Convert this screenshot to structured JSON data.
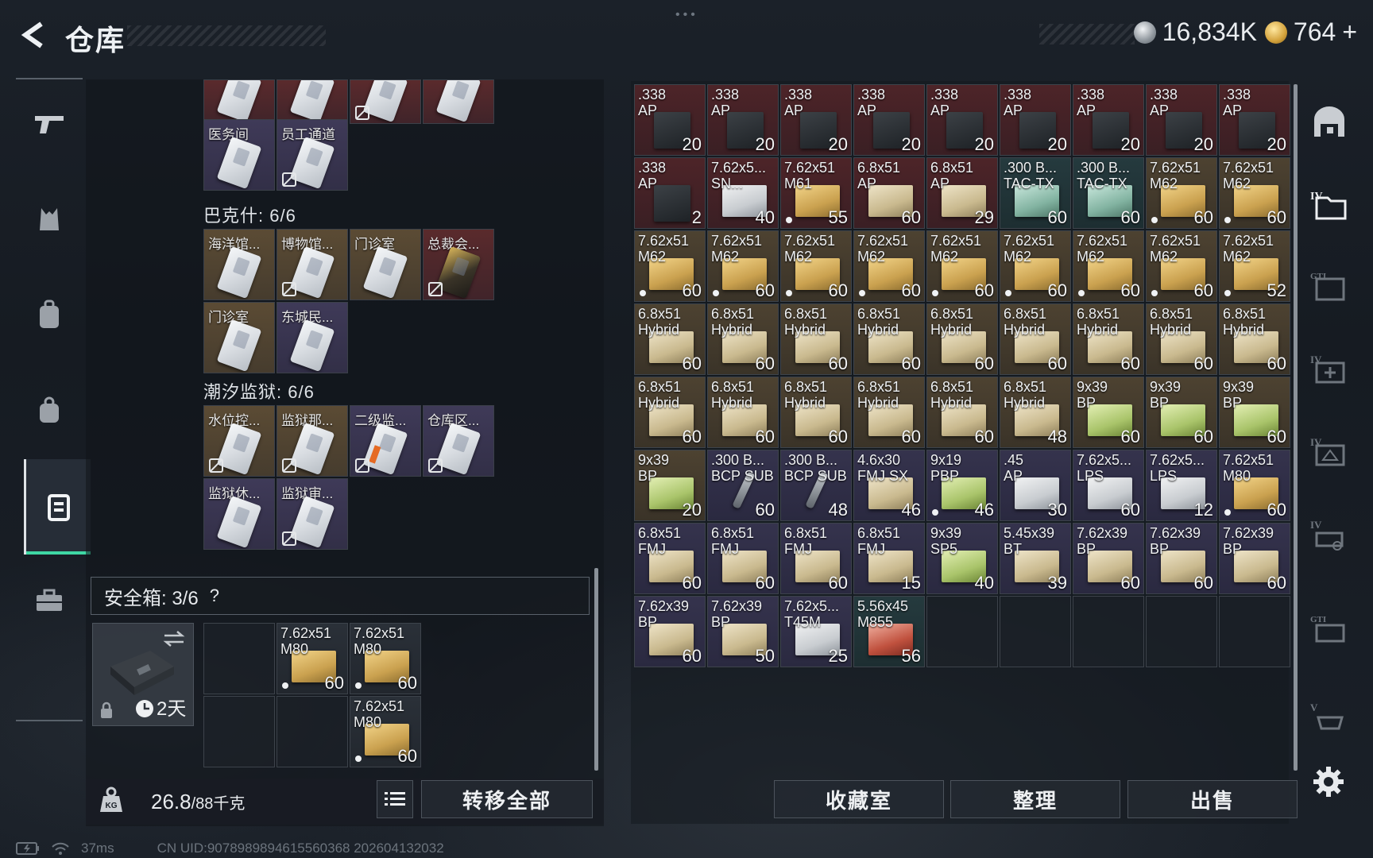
{
  "header": {
    "title": "仓库",
    "currency_silver": "16,834K",
    "currency_gold": "764",
    "plus": "+"
  },
  "left_panel": {
    "top_partial_row": [
      {
        "name": "",
        "color": "red",
        "nodrop": false
      },
      {
        "name": "",
        "color": "red",
        "nodrop": false
      },
      {
        "name": "",
        "color": "red",
        "nodrop": true
      },
      {
        "name": "",
        "color": "red",
        "nodrop": false
      }
    ],
    "row_a": [
      {
        "name": "医务间",
        "color": "purple",
        "nodrop": false
      },
      {
        "name": "员工通道",
        "color": "purple",
        "nodrop": true
      }
    ],
    "section_bakshi": "巴克什: 6/6",
    "row_b": [
      {
        "name": "海洋馆...",
        "color": "gold",
        "nodrop": false
      },
      {
        "name": "博物馆...",
        "color": "gold",
        "nodrop": true
      },
      {
        "name": "门诊室",
        "color": "gold",
        "nodrop": false
      },
      {
        "name": "总裁会...",
        "color": "red",
        "nodrop": true
      }
    ],
    "row_c": [
      {
        "name": "门诊室",
        "color": "gold",
        "nodrop": false
      },
      {
        "name": "东城民...",
        "color": "purple",
        "nodrop": false
      }
    ],
    "section_prison": "潮汐监狱: 6/6",
    "row_d": [
      {
        "name": "水位控...",
        "color": "gold",
        "nodrop": true
      },
      {
        "name": "监狱那...",
        "color": "gold",
        "nodrop": true
      },
      {
        "name": "二级监...",
        "color": "purple",
        "nodrop": true
      },
      {
        "name": "仓库区...",
        "color": "purple",
        "nodrop": true
      }
    ],
    "row_e": [
      {
        "name": "监狱休...",
        "color": "purple",
        "nodrop": false
      },
      {
        "name": "监狱审...",
        "color": "purple",
        "nodrop": true
      }
    ],
    "safe_box": {
      "label": "安全箱: 3/6",
      "help": "?",
      "duration": "2天",
      "items": [
        {
          "l1": "7.62x51",
          "l2": "M80",
          "count": "60",
          "dot": true
        },
        {
          "l1": "7.62x51",
          "l2": "M80",
          "count": "60",
          "dot": true
        },
        {
          "l1": "7.62x51",
          "l2": "M80",
          "count": "60",
          "dot": true
        }
      ]
    },
    "weight_current": "26.8",
    "weight_max": "/88千克",
    "transfer_all": "转移全部"
  },
  "stash": {
    "items": [
      {
        "l1": ".338",
        "l2": "AP",
        "count": "20",
        "bg": "red",
        "box": "mag",
        "dot": false
      },
      {
        "l1": ".338",
        "l2": "AP",
        "count": "20",
        "bg": "red",
        "box": "mag",
        "dot": false
      },
      {
        "l1": ".338",
        "l2": "AP",
        "count": "20",
        "bg": "red",
        "box": "mag",
        "dot": false
      },
      {
        "l1": ".338",
        "l2": "AP",
        "count": "20",
        "bg": "red",
        "box": "mag",
        "dot": false
      },
      {
        "l1": ".338",
        "l2": "AP",
        "count": "20",
        "bg": "red",
        "box": "mag",
        "dot": false
      },
      {
        "l1": ".338",
        "l2": "AP",
        "count": "20",
        "bg": "red",
        "box": "mag",
        "dot": false
      },
      {
        "l1": ".338",
        "l2": "AP",
        "count": "20",
        "bg": "red",
        "box": "mag",
        "dot": false
      },
      {
        "l1": ".338",
        "l2": "AP",
        "count": "20",
        "bg": "red",
        "box": "mag",
        "dot": false
      },
      {
        "l1": ".338",
        "l2": "AP",
        "count": "20",
        "bg": "red",
        "box": "mag",
        "dot": false
      },
      {
        "l1": ".338",
        "l2": "AP",
        "count": "2",
        "bg": "red",
        "box": "mag",
        "dot": false
      },
      {
        "l1": "7.62x5...",
        "l2": "SN...",
        "count": "40",
        "bg": "red",
        "box": "gray",
        "dot": false
      },
      {
        "l1": "7.62x51",
        "l2": "M61",
        "count": "55",
        "bg": "red",
        "box": "yellow",
        "dot": true
      },
      {
        "l1": "6.8x51",
        "l2": "AP",
        "count": "60",
        "bg": "red",
        "box": "beige",
        "dot": false
      },
      {
        "l1": "6.8x51",
        "l2": "AP",
        "count": "29",
        "bg": "red",
        "box": "beige",
        "dot": false
      },
      {
        "l1": ".300 B...",
        "l2": "TAC-TX",
        "count": "60",
        "bg": "teal",
        "box": "teal",
        "dot": false
      },
      {
        "l1": ".300 B...",
        "l2": "TAC-TX",
        "count": "60",
        "bg": "teal",
        "box": "teal",
        "dot": false
      },
      {
        "l1": "7.62x51",
        "l2": "M62",
        "count": "60",
        "bg": "gold",
        "box": "yellow",
        "dot": true
      },
      {
        "l1": "7.62x51",
        "l2": "M62",
        "count": "60",
        "bg": "gold",
        "box": "yellow",
        "dot": true
      },
      {
        "l1": "7.62x51",
        "l2": "M62",
        "count": "60",
        "bg": "gold",
        "box": "yellow",
        "dot": true
      },
      {
        "l1": "7.62x51",
        "l2": "M62",
        "count": "60",
        "bg": "gold",
        "box": "yellow",
        "dot": true
      },
      {
        "l1": "7.62x51",
        "l2": "M62",
        "count": "60",
        "bg": "gold",
        "box": "yellow",
        "dot": true
      },
      {
        "l1": "7.62x51",
        "l2": "M62",
        "count": "60",
        "bg": "gold",
        "box": "yellow",
        "dot": true
      },
      {
        "l1": "7.62x51",
        "l2": "M62",
        "count": "60",
        "bg": "gold",
        "box": "yellow",
        "dot": true
      },
      {
        "l1": "7.62x51",
        "l2": "M62",
        "count": "60",
        "bg": "gold",
        "box": "yellow",
        "dot": true
      },
      {
        "l1": "7.62x51",
        "l2": "M62",
        "count": "60",
        "bg": "gold",
        "box": "yellow",
        "dot": true
      },
      {
        "l1": "7.62x51",
        "l2": "M62",
        "count": "60",
        "bg": "gold",
        "box": "yellow",
        "dot": true
      },
      {
        "l1": "7.62x51",
        "l2": "M62",
        "count": "52",
        "bg": "gold",
        "box": "yellow",
        "dot": true
      },
      {
        "l1": "6.8x51",
        "l2": "Hybrid",
        "count": "60",
        "bg": "gold",
        "box": "beige",
        "dot": false
      },
      {
        "l1": "6.8x51",
        "l2": "Hybrid",
        "count": "60",
        "bg": "gold",
        "box": "beige",
        "dot": false
      },
      {
        "l1": "6.8x51",
        "l2": "Hybrid",
        "count": "60",
        "bg": "gold",
        "box": "beige",
        "dot": false
      },
      {
        "l1": "6.8x51",
        "l2": "Hybrid",
        "count": "60",
        "bg": "gold",
        "box": "beige",
        "dot": false
      },
      {
        "l1": "6.8x51",
        "l2": "Hybrid",
        "count": "60",
        "bg": "gold",
        "box": "beige",
        "dot": false
      },
      {
        "l1": "6.8x51",
        "l2": "Hybrid",
        "count": "60",
        "bg": "gold",
        "box": "beige",
        "dot": false
      },
      {
        "l1": "6.8x51",
        "l2": "Hybrid",
        "count": "60",
        "bg": "gold",
        "box": "beige",
        "dot": false
      },
      {
        "l1": "6.8x51",
        "l2": "Hybrid",
        "count": "60",
        "bg": "gold",
        "box": "beige",
        "dot": false
      },
      {
        "l1": "6.8x51",
        "l2": "Hybrid",
        "count": "60",
        "bg": "gold",
        "box": "beige",
        "dot": false
      },
      {
        "l1": "6.8x51",
        "l2": "Hybrid",
        "count": "60",
        "bg": "gold",
        "box": "beige",
        "dot": false
      },
      {
        "l1": "6.8x51",
        "l2": "Hybrid",
        "count": "60",
        "bg": "gold",
        "box": "beige",
        "dot": false
      },
      {
        "l1": "6.8x51",
        "l2": "Hybrid",
        "count": "60",
        "bg": "gold",
        "box": "beige",
        "dot": false
      },
      {
        "l1": "6.8x51",
        "l2": "Hybrid",
        "count": "60",
        "bg": "gold",
        "box": "beige",
        "dot": false
      },
      {
        "l1": "6.8x51",
        "l2": "Hybrid",
        "count": "60",
        "bg": "gold",
        "box": "beige",
        "dot": false
      },
      {
        "l1": "6.8x51",
        "l2": "Hybrid",
        "count": "48",
        "bg": "gold",
        "box": "beige",
        "dot": false
      },
      {
        "l1": "9x39",
        "l2": "BP",
        "count": "60",
        "bg": "gold",
        "box": "green",
        "dot": false
      },
      {
        "l1": "9x39",
        "l2": "BP",
        "count": "60",
        "bg": "gold",
        "box": "green",
        "dot": false
      },
      {
        "l1": "9x39",
        "l2": "BP",
        "count": "60",
        "bg": "gold",
        "box": "green",
        "dot": false
      },
      {
        "l1": "9x39",
        "l2": "BP",
        "count": "20",
        "bg": "gold",
        "box": "green",
        "dot": false
      },
      {
        "l1": ".300 B...",
        "l2": "BCP SUB",
        "count": "60",
        "bg": "purple",
        "box": "bullet",
        "dot": false
      },
      {
        "l1": ".300 B...",
        "l2": "BCP SUB",
        "count": "48",
        "bg": "purple",
        "box": "bullet",
        "dot": false
      },
      {
        "l1": "4.6x30",
        "l2": "FMJ SX",
        "count": "46",
        "bg": "purple",
        "box": "beige",
        "dot": false
      },
      {
        "l1": "9x19",
        "l2": "PBP",
        "count": "46",
        "bg": "purple",
        "box": "green",
        "dot": true
      },
      {
        "l1": ".45",
        "l2": "AP",
        "count": "30",
        "bg": "purple",
        "box": "gray",
        "dot": false
      },
      {
        "l1": "7.62x5...",
        "l2": "LPS",
        "count": "60",
        "bg": "purple",
        "box": "gray",
        "dot": false
      },
      {
        "l1": "7.62x5...",
        "l2": "LPS",
        "count": "12",
        "bg": "purple",
        "box": "gray",
        "dot": false
      },
      {
        "l1": "7.62x51",
        "l2": "M80",
        "count": "60",
        "bg": "purple",
        "box": "yellow",
        "dot": true
      },
      {
        "l1": "6.8x51",
        "l2": "FMJ",
        "count": "60",
        "bg": "purple",
        "box": "beige",
        "dot": false
      },
      {
        "l1": "6.8x51",
        "l2": "FMJ",
        "count": "60",
        "bg": "purple",
        "box": "beige",
        "dot": false
      },
      {
        "l1": "6.8x51",
        "l2": "FMJ",
        "count": "60",
        "bg": "purple",
        "box": "beige",
        "dot": false
      },
      {
        "l1": "6.8x51",
        "l2": "FMJ",
        "count": "15",
        "bg": "purple",
        "box": "beige",
        "dot": false
      },
      {
        "l1": "9x39",
        "l2": "SP5",
        "count": "40",
        "bg": "purple",
        "box": "green",
        "dot": false
      },
      {
        "l1": "5.45x39",
        "l2": "BT",
        "count": "39",
        "bg": "purple",
        "box": "beige",
        "dot": false
      },
      {
        "l1": "7.62x39",
        "l2": "BP",
        "count": "60",
        "bg": "purple",
        "box": "beige",
        "dot": false
      },
      {
        "l1": "7.62x39",
        "l2": "BP",
        "count": "60",
        "bg": "purple",
        "box": "beige",
        "dot": false
      },
      {
        "l1": "7.62x39",
        "l2": "BP",
        "count": "60",
        "bg": "purple",
        "box": "beige",
        "dot": false
      },
      {
        "l1": "7.62x39",
        "l2": "BP",
        "count": "60",
        "bg": "purple",
        "box": "beige",
        "dot": false
      },
      {
        "l1": "7.62x39",
        "l2": "BP",
        "count": "50",
        "bg": "purple",
        "box": "beige",
        "dot": false
      },
      {
        "l1": "7.62x5...",
        "l2": "T45M",
        "count": "25",
        "bg": "purple",
        "box": "gray",
        "dot": false
      },
      {
        "l1": "5.56x45",
        "l2": "M855",
        "count": "56",
        "bg": "teal",
        "box": "red",
        "dot": false
      }
    ],
    "buttons": {
      "collection": "收藏室",
      "organize": "整理",
      "sell": "出售"
    }
  },
  "status_bar": {
    "ping": "37ms",
    "uid": "CN UID:9078989894615560368 202604132032"
  }
}
